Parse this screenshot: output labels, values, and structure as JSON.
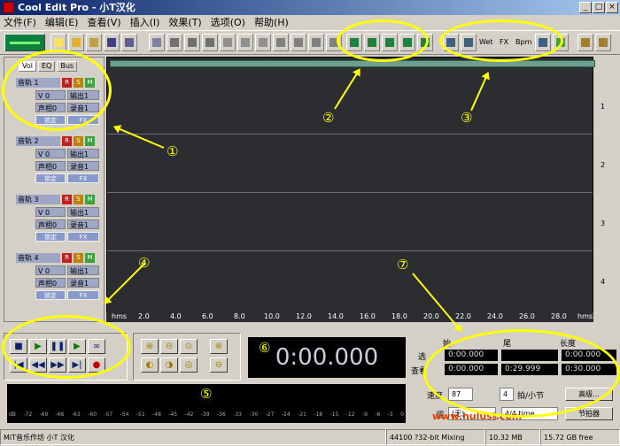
{
  "window": {
    "title": "Cool Edit Pro - 小T汉化"
  },
  "menu": [
    "文件(F)",
    "编辑(E)",
    "查看(V)",
    "插入(I)",
    "效果(T)",
    "选项(O)",
    "帮助(H)"
  ],
  "toolbar": {
    "labels": [
      "Wet",
      "FX",
      "Bpm"
    ]
  },
  "track_tabs": [
    "Vol",
    "EQ",
    "Bus"
  ],
  "tracks": [
    {
      "name": "音轨 1",
      "vol": "V 0",
      "pan": "声相0",
      "out": "输出1",
      "rec": "录音1",
      "lock": "锁定",
      "fx": "FX",
      "num": "1"
    },
    {
      "name": "音轨 2",
      "vol": "V 0",
      "pan": "声相0",
      "out": "输出1",
      "rec": "录音1",
      "lock": "锁定",
      "fx": "FX",
      "num": "2"
    },
    {
      "name": "音轨 3",
      "vol": "V 0",
      "pan": "声相0",
      "out": "输出1",
      "rec": "录音1",
      "lock": "锁定",
      "fx": "FX",
      "num": "3"
    },
    {
      "name": "音轨 4",
      "vol": "V 0",
      "pan": "声相0",
      "out": "输出1",
      "rec": "录音1",
      "lock": "锁定",
      "fx": "FX",
      "num": "4"
    }
  ],
  "rsm": {
    "r": "R",
    "s": "S",
    "m": "M"
  },
  "ruler": [
    "hms",
    "2.0",
    "4.0",
    "6.0",
    "8.0",
    "10.0",
    "12.0",
    "14.0",
    "16.0",
    "18.0",
    "20.0",
    "22.0",
    "24.0",
    "26.0",
    "28.0",
    "hms"
  ],
  "time_display": "0:00.000",
  "selection": {
    "headers": [
      "始",
      "尾",
      "长度"
    ],
    "row_labels": [
      "选",
      "查看"
    ],
    "sel_begin": "0:00.000",
    "sel_end": "",
    "sel_length": "0:00.000",
    "view_begin": "0:00.000",
    "view_end": "0:29.999",
    "view_length": "0:30.000"
  },
  "tempo": {
    "label": "速度",
    "value": "87",
    "beats": "4",
    "beats_label": "拍/小节",
    "advanced": "高级...",
    "key_label": "调",
    "key_value": "(无)",
    "time_sig": "4/4 time",
    "metronome": "节拍器"
  },
  "meter_labels": [
    "dB",
    "-72",
    "-69",
    "-66",
    "-63",
    "-60",
    "-57",
    "-54",
    "-51",
    "-48",
    "-45",
    "-42",
    "-39",
    "-36",
    "-33",
    "-30",
    "-27",
    "-24",
    "-21",
    "-18",
    "-15",
    "-12",
    "-9",
    "-6",
    "-3",
    "0"
  ],
  "status": {
    "app": "MiT音乐作坊 小T 汉化",
    "format": "44100 ?32-bit Mixing",
    "mem": "10.32 MB",
    "free": "15.72 GB free"
  },
  "watermark": "www.hulusi.com",
  "callouts": [
    "①",
    "②",
    "③",
    "④",
    "⑤",
    "⑥",
    "⑦"
  ]
}
